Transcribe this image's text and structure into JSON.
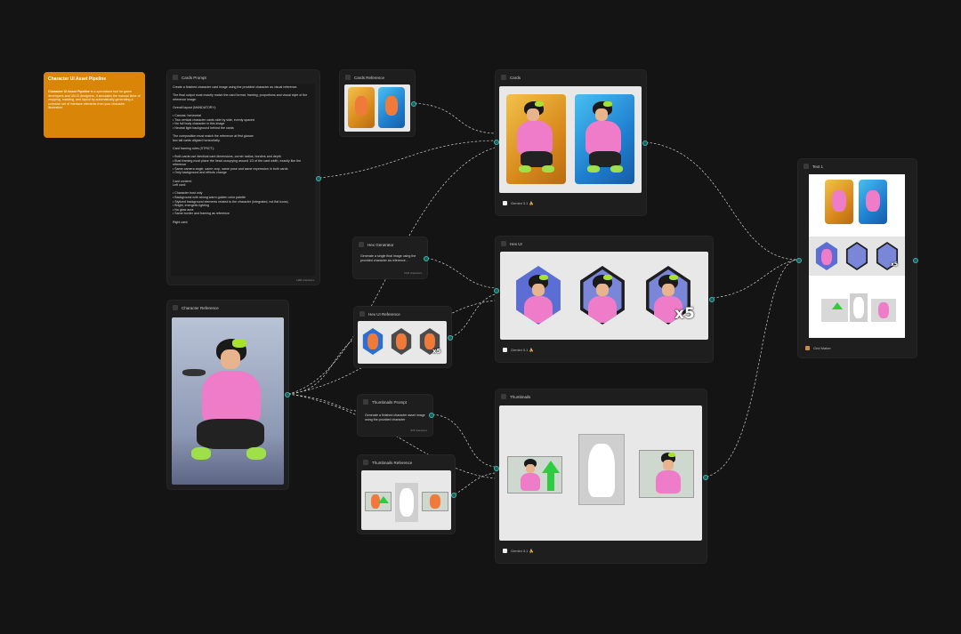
{
  "sticky": {
    "title": "Character UI Asset Pipeline",
    "body_bold": "Character UI Asset Pipeline",
    "body": " is a specialized tool for game developers and UI/UX designers. It simulates the manual labor of cropping, masking, and layout by automatically generating a cohesive set of interface elements from your character illustration."
  },
  "nodes": {
    "cards_prompt": {
      "title": "Cards Prompt",
      "text": "Create a finished character card image using the provided character as visual reference.\n\nThe final output must exactly match the card format, framing, proportions and visual style of the reference image.\n\nOverall layout (MANDATORY):\n\n• Canvas: horizontal\n• Two vertical character cards side by side, evenly spaced\n• No full body character in this image\n• Neutral light background behind the cards\n\nThe composition must match the reference at first glance:\ntwo tall cards aligned horizontally.\n\nCard framing rules (STRICT):\n\n• Both cards use identical card dimensions, corner radius, borders and depth\n• Bust framing must place the head occupying around 1/3 of the card width, exactly like the reference\n• Same camera angle, same crop, same pose and same expression in both cards\n• Only background and effects change\n\nCard content:\nLeft card:\n\n• Character bust only\n• Background with strong warm golden color palette\n• Stylized background elements related to the character (integrated, not flat icons)\n• Bright, energetic lighting\n• No glow aura\n• Same border and framing as reference\n\nRight card:",
      "count": "1486 characters"
    },
    "cards_reference": {
      "title": "Cards Reference"
    },
    "cards": {
      "title": "Cards",
      "model": "Gemini 3.1 🍌"
    },
    "character_reference": {
      "title": "Character Reference"
    },
    "hex_generator": {
      "title": "Hex Generator",
      "text": "Generate a single final image using the provided character as reference...",
      "count": "1046 characters"
    },
    "hex_ui_reference": {
      "title": "Hex UI Reference",
      "badge": "x5"
    },
    "hex_ui": {
      "title": "Hex UI",
      "model": "Gemini 3.1 🍌",
      "badge": "x5"
    },
    "thumbnails_prompt": {
      "title": "Thumbnails Prompt",
      "text": "Generate a finished character asset image using the provided character",
      "count": "878 characters"
    },
    "thumbnails_reference": {
      "title": "Thumbnails Reference"
    },
    "thumbnails": {
      "title": "Thumbnails",
      "model": "Gemini 3.1 🍌"
    },
    "text1": {
      "title": "Text 1",
      "footer": "Grid Maker",
      "badge": "x5"
    }
  },
  "colors": {
    "canvas_bg": "#141414",
    "node_bg": "#1e1e1e",
    "sticky_bg": "#d98508",
    "wire": "#d0d0d0",
    "port": "#3fb5a8"
  }
}
